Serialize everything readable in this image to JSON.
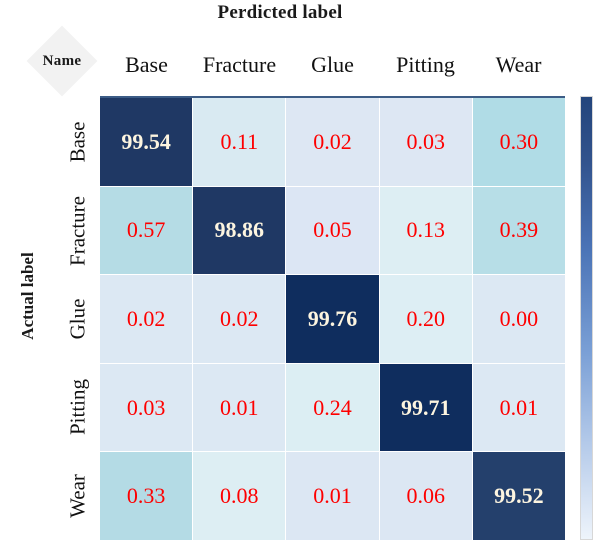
{
  "title": "Perdicted label",
  "corner": {
    "label": "Name"
  },
  "axes": {
    "x_title": "Perdicted label",
    "y_title": "Actual label"
  },
  "colors": {
    "diagonal": "#1f3864",
    "text_offdiagonal": "#fe0000",
    "text_diagonal": "#fdf5e0",
    "corner_diamond": "#f2f2f2",
    "top_rule": "#3c5c86",
    "colorbar_top": "#23457c",
    "colorbar_bottom": "#eef4fb"
  },
  "chart_data": {
    "type": "heatmap",
    "title": "Perdicted label",
    "xlabel": "Perdicted label",
    "ylabel": "Actual label",
    "corner_label": "Name",
    "categories": [
      "Base",
      "Fracture",
      "Glue",
      "Pitting",
      "Wear"
    ],
    "x_tick_labels": [
      "Base",
      "Fracture",
      "Glue",
      "Pitting",
      "Wear"
    ],
    "y_tick_labels": [
      "Base",
      "Fracture",
      "Glue",
      "Pitting",
      "Wear"
    ],
    "units": "percent",
    "grid": false,
    "legend": "colorbar-right",
    "colorbar": {
      "orientation": "vertical",
      "position": "right",
      "min": 0,
      "max": 100
    },
    "rows": [
      {
        "label": "Base",
        "values": [
          99.54,
          0.11,
          0.02,
          0.03,
          0.3
        ]
      },
      {
        "label": "Fracture",
        "values": [
          0.57,
          98.86,
          0.05,
          0.13,
          0.39
        ]
      },
      {
        "label": "Glue",
        "values": [
          0.02,
          0.02,
          99.76,
          0.2,
          0.0
        ]
      },
      {
        "label": "Pitting",
        "values": [
          0.03,
          0.01,
          0.24,
          99.71,
          0.01
        ]
      },
      {
        "label": "Wear",
        "values": [
          0.33,
          0.08,
          0.01,
          0.06,
          99.52
        ]
      }
    ],
    "cells": [
      [
        {
          "text": "99.54",
          "color": "#1f3864",
          "diagonal": true
        },
        {
          "text": "0.11",
          "color": "#d9eaf2",
          "diagonal": false
        },
        {
          "text": "0.02",
          "color": "#dde7f3",
          "diagonal": false
        },
        {
          "text": "0.03",
          "color": "#dde7f3",
          "diagonal": false
        },
        {
          "text": "0.30",
          "color": "#b0dce6",
          "diagonal": false
        }
      ],
      [
        {
          "text": "0.57",
          "color": "#b5dce5",
          "diagonal": false
        },
        {
          "text": "98.86",
          "color": "#1f3864",
          "diagonal": true
        },
        {
          "text": "0.05",
          "color": "#dce6f4",
          "diagonal": false
        },
        {
          "text": "0.13",
          "color": "#ddeef3",
          "diagonal": false
        },
        {
          "text": "0.39",
          "color": "#b7dee7",
          "diagonal": false
        }
      ],
      [
        {
          "text": "0.02",
          "color": "#dce8f3",
          "diagonal": false
        },
        {
          "text": "0.02",
          "color": "#dce8f3",
          "diagonal": false
        },
        {
          "text": "99.76",
          "color": "#0f2d5e",
          "diagonal": true
        },
        {
          "text": "0.20",
          "color": "#ddeef4",
          "diagonal": false
        },
        {
          "text": "0.00",
          "color": "#dce8f3",
          "diagonal": false
        }
      ],
      [
        {
          "text": "0.03",
          "color": "#dce8f3",
          "diagonal": false
        },
        {
          "text": "0.01",
          "color": "#dce8f3",
          "diagonal": false
        },
        {
          "text": "0.24",
          "color": "#dceef3",
          "diagonal": false
        },
        {
          "text": "99.71",
          "color": "#0f2d5e",
          "diagonal": true
        },
        {
          "text": "0.01",
          "color": "#dce8f3",
          "diagonal": false
        }
      ],
      [
        {
          "text": "0.33",
          "color": "#b4dbe5",
          "diagonal": false
        },
        {
          "text": "0.08",
          "color": "#ddeef3",
          "diagonal": false
        },
        {
          "text": "0.01",
          "color": "#dce7f3",
          "diagonal": false
        },
        {
          "text": "0.06",
          "color": "#dce7f3",
          "diagonal": false
        },
        {
          "text": "99.52",
          "color": "#24406c",
          "diagonal": true
        }
      ]
    ]
  }
}
